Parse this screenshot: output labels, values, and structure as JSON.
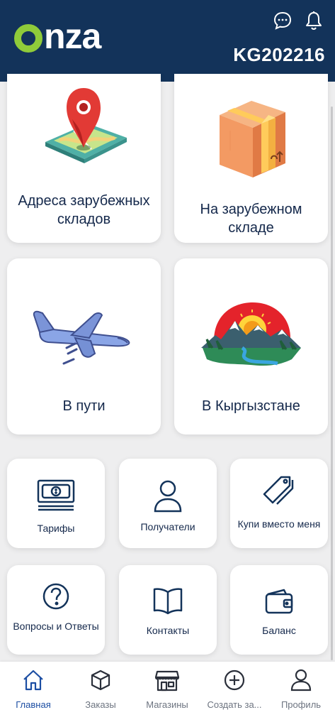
{
  "header": {
    "logo_text": "nza",
    "account_code": "KG202216",
    "chat_icon": "chat-bubble-icon",
    "bell_icon": "bell-icon"
  },
  "colors": {
    "header_bg": "#13335a",
    "logo_accent": "#8fcb3a",
    "active_nav": "#1c4ea3",
    "inactive_nav": "#6d7480"
  },
  "main": {
    "large_tiles": [
      {
        "label": "Адреса зарубежных складов",
        "icon": "map-pin-icon"
      },
      {
        "label": "На зарубежном складе",
        "icon": "package-box-icon"
      },
      {
        "label": "В пути",
        "icon": "airplane-icon"
      },
      {
        "label": "В Кыргызстане",
        "icon": "kyrgyzstan-landscape-icon"
      }
    ],
    "small_tiles": [
      {
        "label": "Тарифы",
        "icon": "banknote-icon"
      },
      {
        "label": "Получатели",
        "icon": "user-icon"
      },
      {
        "label": "Купи вместо меня",
        "icon": "price-tag-icon"
      },
      {
        "label": "Вопросы и Ответы",
        "icon": "question-icon"
      },
      {
        "label": "Контакты",
        "icon": "book-icon"
      },
      {
        "label": "Баланс",
        "icon": "wallet-icon"
      }
    ]
  },
  "bottom_nav": {
    "items": [
      {
        "label": "Главная",
        "icon": "home-icon",
        "active": true
      },
      {
        "label": "Заказы",
        "icon": "box-icon",
        "active": false
      },
      {
        "label": "Магазины",
        "icon": "store-icon",
        "active": false
      },
      {
        "label": "Создать за...",
        "icon": "plus-circle-icon",
        "active": false
      },
      {
        "label": "Профиль",
        "icon": "profile-icon",
        "active": false
      }
    ]
  }
}
